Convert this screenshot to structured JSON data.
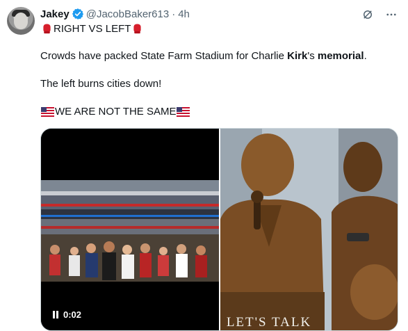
{
  "author": {
    "name": "Jakey",
    "handle": "@JacobBaker613",
    "separator": "·",
    "time": "4h"
  },
  "post": {
    "line1": "RIGHT VS LEFT",
    "line2_part1": "Crowds have packed State Farm Stadium for Charlie ",
    "line2_bold1": "Kirk",
    "line2_part2": "'s ",
    "line2_bold2": "memorial",
    "line2_part3": ".",
    "line3": "The left burns cities down!",
    "line4": "WE ARE NOT THE SAME"
  },
  "media": {
    "video_time": "0:02",
    "photo_text": "LET'S TALK"
  },
  "icons": [
    "verified-badge-icon",
    "boxing-glove-icon",
    "us-flag-icon",
    "grok-icon",
    "more-icon",
    "pause-icon"
  ],
  "colors": {
    "verified": "#1d9bf0",
    "secondary_text": "#536471",
    "primary_text": "#0f1419"
  }
}
